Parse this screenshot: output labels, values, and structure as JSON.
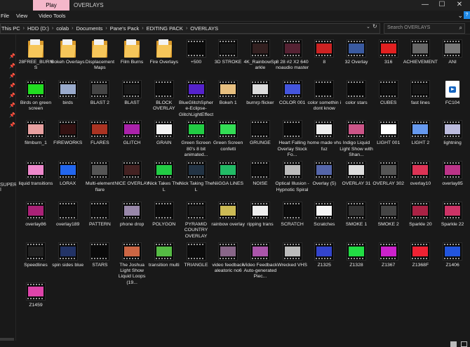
{
  "window": {
    "title": "OVERLAYS",
    "tab_label": "Play",
    "controls": [
      "—",
      "☐",
      "✕"
    ]
  },
  "ribbon": {
    "items": [
      "File",
      "View",
      "Video Tools"
    ]
  },
  "address": {
    "crumbs": [
      "This PC",
      "HDD (D:)",
      "colab",
      "Documents",
      "Pane's Pack",
      "EDITING PACK",
      "OVERLAYS"
    ],
    "search_placeholder": "Search OVERLAYS"
  },
  "nav": {
    "label": "SUPER I"
  },
  "items": [
    {
      "name": "28FREE_BURNS",
      "type": "folder"
    },
    {
      "name": "Bokeh Overlays",
      "type": "folder"
    },
    {
      "name": "Displacement Maps",
      "type": "folder"
    },
    {
      "name": "Film Burns",
      "type": "folder"
    },
    {
      "name": "Fire Overlays",
      "type": "folder"
    },
    {
      "name": "+500",
      "type": "video",
      "color": "#0d0d0d"
    },
    {
      "name": "3D STROKE",
      "type": "video",
      "color": "#161616"
    },
    {
      "name": "4K_RainbowSparkle",
      "type": "video",
      "color": "#332020"
    },
    {
      "name": "8 28 #2 X2 640 noaudio master",
      "type": "video",
      "color": "#552233"
    },
    {
      "name": "8",
      "type": "video",
      "color": "#cc2222"
    },
    {
      "name": "32 Overlay",
      "type": "video",
      "color": "#3a5aa0"
    },
    {
      "name": "316",
      "type": "video",
      "color": "#e02020"
    },
    {
      "name": "ACHIEVEMENT",
      "type": "video",
      "color": "#666666"
    },
    {
      "name": "ANI",
      "type": "video",
      "color": "#777777"
    },
    {
      "name": "Birds on green screen",
      "type": "video",
      "color": "#22dd22"
    },
    {
      "name": "birds",
      "type": "video",
      "color": "#99aacc"
    },
    {
      "name": "BLAST 2",
      "type": "video",
      "color": "#444444"
    },
    {
      "name": "BLAST",
      "type": "video",
      "color": "#1a1a1a"
    },
    {
      "name": "BLOCK OVERLAY",
      "type": "video",
      "color": "#0f0f0f"
    },
    {
      "name": "BlueGlitchSphere-Eclipse-GlitchLightEffect",
      "type": "video",
      "color": "#5522cc"
    },
    {
      "name": "Bokeh 1",
      "type": "video",
      "color": "#e8c080"
    },
    {
      "name": "burnrp flicker",
      "type": "video",
      "color": "#dddddd"
    },
    {
      "name": "COLOR 001",
      "type": "video",
      "color": "#4455dd"
    },
    {
      "name": "color somethin i dont know",
      "type": "video",
      "color": "#0a0a0a"
    },
    {
      "name": "color stars",
      "type": "video",
      "color": "#0b0b0b"
    },
    {
      "name": "CUBES",
      "type": "video",
      "color": "#101010"
    },
    {
      "name": "fast lines",
      "type": "video",
      "color": "#151515"
    },
    {
      "name": "FC104",
      "type": "doc"
    },
    {
      "name": "filmburn_1",
      "type": "video",
      "color": "#e8a0a0"
    },
    {
      "name": "FIREWORKS",
      "type": "video",
      "color": "#331111"
    },
    {
      "name": "FLARES",
      "type": "video",
      "color": "#aa3322"
    },
    {
      "name": "GLITCH",
      "type": "video",
      "color": "#aa22aa"
    },
    {
      "name": "GRAIN",
      "type": "video",
      "color": "#f4f4f4"
    },
    {
      "name": "Green Screen 80's 8 bit animated...",
      "type": "video",
      "color": "#22cc44"
    },
    {
      "name": "Green Screen confetti",
      "type": "video",
      "color": "#33dd55"
    },
    {
      "name": "GRUNGE",
      "type": "video",
      "color": "#111111"
    },
    {
      "name": "Heart Falling Overlay Stock Fo...",
      "type": "video",
      "color": "#0c0c0c"
    },
    {
      "name": "home made vhs fuz",
      "type": "video",
      "color": "#eeeeee"
    },
    {
      "name": "Indigo Liquid Light Show with Shan...",
      "type": "video",
      "color": "#cc5588"
    },
    {
      "name": "LIGHT 001",
      "type": "video",
      "color": "#ffffff"
    },
    {
      "name": "LIGHT 2",
      "type": "video",
      "color": "#6699ee"
    },
    {
      "name": "lightning",
      "type": "video",
      "color": "#bbbbdd"
    },
    {
      "name": "liquid transitions",
      "type": "video",
      "color": "#ee88cc"
    },
    {
      "name": "LORAX",
      "type": "video",
      "color": "#2266ee"
    },
    {
      "name": "Multi-element flare",
      "type": "video",
      "color": "#555555"
    },
    {
      "name": "NICE OVERLAY",
      "type": "video",
      "color": "#442222"
    },
    {
      "name": "Nick Takes The L",
      "type": "video",
      "color": "#22cc44"
    },
    {
      "name": "Nick Taking The L",
      "type": "video",
      "color": "#223344"
    },
    {
      "name": "NiiGGA LiNES",
      "type": "video",
      "color": "#22bb66"
    },
    {
      "name": "NOISE",
      "type": "video",
      "color": "#101010"
    },
    {
      "name": "Optical Illusion - Hypnotic Spiral",
      "type": "video",
      "color": "#bbbbbb"
    },
    {
      "name": "Overlay (5)",
      "type": "video",
      "color": "#5566aa"
    },
    {
      "name": "OVERLAY 31",
      "type": "video",
      "color": "#dddddd"
    },
    {
      "name": "OVERLAY 302",
      "type": "video",
      "color": "#555555"
    },
    {
      "name": "overlay10",
      "type": "video",
      "color": "#dd3355"
    },
    {
      "name": "overlay85",
      "type": "video",
      "color": "#bb3388"
    },
    {
      "name": "overlay86",
      "type": "video",
      "color": "#aa2277"
    },
    {
      "name": "overlay189",
      "type": "video",
      "color": "#111111"
    },
    {
      "name": "PATTERN",
      "type": "video",
      "color": "#101010"
    },
    {
      "name": "phone drop",
      "type": "video",
      "color": "#9988aa"
    },
    {
      "name": "POLYGON",
      "type": "video",
      "color": "#0d0d0d"
    },
    {
      "name": "PYRAMID COUNTRY OVERLAY",
      "type": "video",
      "color": "#1a1a1a"
    },
    {
      "name": "rainbow overlay",
      "type": "video",
      "color": "#ccbb55"
    },
    {
      "name": "ripping trans",
      "type": "video",
      "color": "#eeeeee"
    },
    {
      "name": "SCRATCH",
      "type": "video",
      "color": "#0e0e0e"
    },
    {
      "name": "Scratches",
      "type": "video",
      "color": "#f6f6f6"
    },
    {
      "name": "SMOKE 1",
      "type": "video",
      "color": "#333333"
    },
    {
      "name": "SMOKE 2",
      "type": "video",
      "color": "#444444"
    },
    {
      "name": "Sparkle 20",
      "type": "video",
      "color": "#aa2244"
    },
    {
      "name": "Sparkle 22",
      "type": "video",
      "color": "#cc3366"
    },
    {
      "name": "Speedlines",
      "type": "video",
      "color": "#222222"
    },
    {
      "name": "spin sides blue",
      "type": "video",
      "color": "#223366"
    },
    {
      "name": "STARS",
      "type": "video",
      "color": "#0a0a0a"
    },
    {
      "name": "The Joshua Light Show Liquid Loops (19...",
      "type": "video",
      "color": "#cc6644"
    },
    {
      "name": "transition multi",
      "type": "video",
      "color": "#55bb44"
    },
    {
      "name": "TRIANGLE",
      "type": "video",
      "color": "#0d0d0d"
    },
    {
      "name": "video feedback aleatoric no6",
      "type": "video",
      "color": "#886688"
    },
    {
      "name": "Video Feedback Auto-generated Piec...",
      "type": "video",
      "color": "#aa55aa"
    },
    {
      "name": "Wrecked VHS",
      "type": "video",
      "color": "#bbbbbb"
    },
    {
      "name": "Z1325",
      "type": "video",
      "color": "#3344cc"
    },
    {
      "name": "Z1328",
      "type": "video",
      "color": "#22dd44"
    },
    {
      "name": "Z1367",
      "type": "video",
      "color": "#cc22cc"
    },
    {
      "name": "Z1368F",
      "type": "video",
      "color": "#ee2233"
    },
    {
      "name": "Z1406",
      "type": "video",
      "color": "#2255dd"
    },
    {
      "name": "Z1459",
      "type": "video",
      "color": "#dd44aa"
    }
  ]
}
